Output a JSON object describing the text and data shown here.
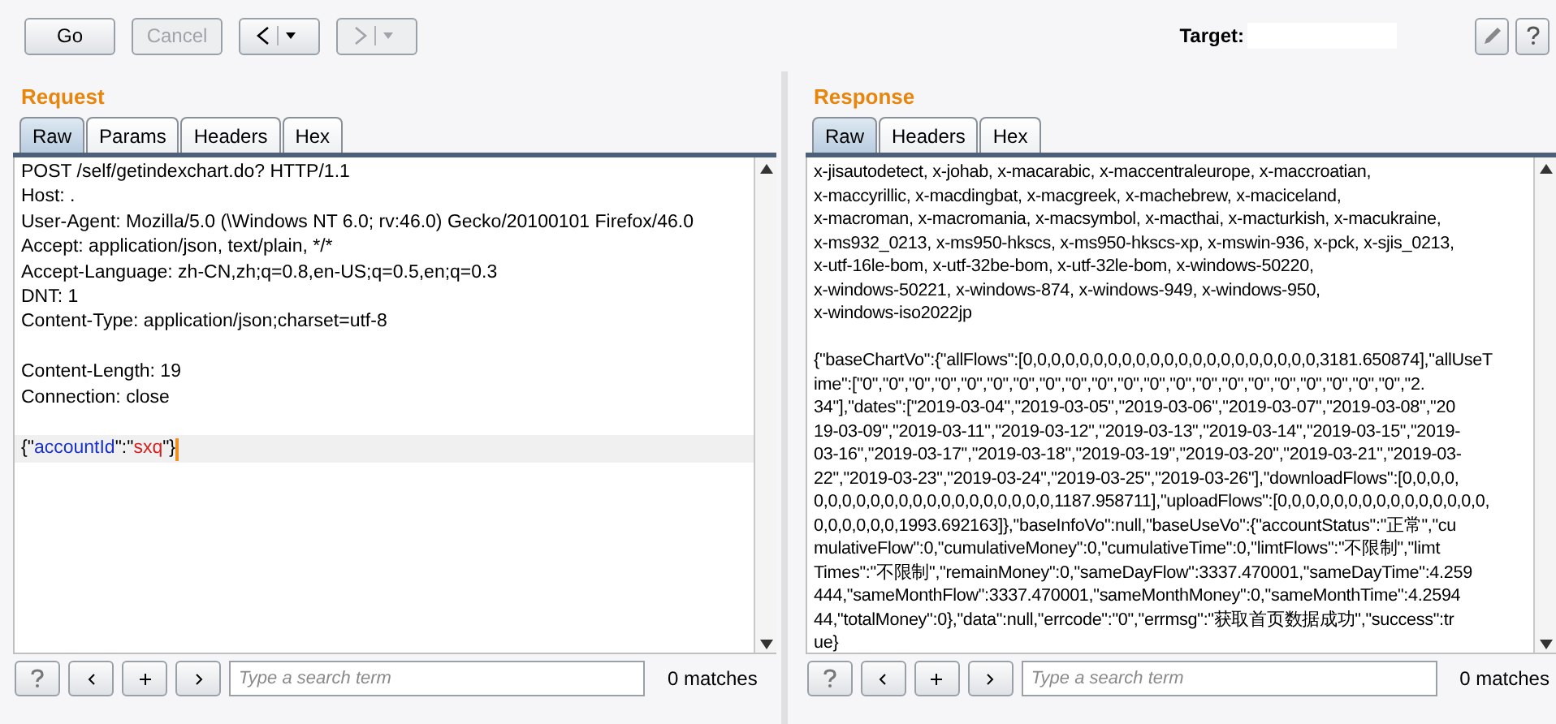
{
  "toolbar": {
    "buttons": [
      {
        "kind": "text",
        "label": "Go",
        "disabled": false
      },
      {
        "kind": "text",
        "label": "Cancel",
        "disabled": true
      },
      {
        "kind": "back",
        "disabled": false
      },
      {
        "kind": "forward",
        "disabled": true
      }
    ],
    "target_label": "Target:"
  },
  "request": {
    "title": "Request",
    "tabs": [
      {
        "label": "Raw",
        "selected": true
      },
      {
        "label": "Params",
        "selected": false
      },
      {
        "label": "Headers",
        "selected": false
      },
      {
        "label": "Hex",
        "selected": false
      }
    ],
    "blocks": [
      [
        "POST /self/getindexchart.do? HTTP/1.1",
        "Host: .",
        "User-Agent: Mozilla/5.0 (\\Windows NT 6.0; rv:46.0) Gecko/20100101 Firefox/46.0",
        "Accept: application/json, text/plain, */*",
        "Accept-Language: zh-CN,zh;q=0.8,en-US;q=0.5,en;q=0.3",
        "DNT: 1",
        "Content-Type: application/json;charset=utf-8"
      ],
      [
        "Content-Length: 19",
        "Connection: close"
      ]
    ],
    "body": [
      {
        "kind": "punct",
        "text": "{\""
      },
      {
        "kind": "key",
        "text": "accountId"
      },
      {
        "kind": "punct",
        "text": "\":\""
      },
      {
        "kind": "value",
        "text": "sxq"
      },
      {
        "kind": "punct",
        "text": "\"}"
      }
    ],
    "search": {
      "placeholder": "Type a search term",
      "matches": "0 matches"
    }
  },
  "response": {
    "title": "Response",
    "tabs": [
      {
        "label": "Raw",
        "selected": true
      },
      {
        "label": "Headers",
        "selected": false
      },
      {
        "label": "Hex",
        "selected": false
      }
    ],
    "blocks": [
      [
        "x-jisautodetect, x-johab, x-macarabic, x-maccentraleurope, x-maccroatian,",
        "x-maccyrillic, x-macdingbat, x-macgreek, x-machebrew, x-maciceland,",
        "x-macroman, x-macromania, x-macsymbol, x-macthai, x-macturkish, x-macukraine,",
        "x-ms932_0213, x-ms950-hkscs, x-ms950-hkscs-xp, x-mswin-936, x-pck, x-sjis_0213,",
        "x-utf-16le-bom, x-utf-32be-bom, x-utf-32le-bom, x-windows-50220,",
        "x-windows-50221, x-windows-874, x-windows-949, x-windows-950,",
        "x-windows-iso2022jp"
      ],
      [
        "{\"baseChartVo\":{\"allFlows\":[0,0,0,0,0,0,0,0,0,0,0,0,0,0,0,0,0,0,0,0,0,3181.650874],\"allUseT",
        "ime\":[\"0\",\"0\",\"0\",\"0\",\"0\",\"0\",\"0\",\"0\",\"0\",\"0\",\"0\",\"0\",\"0\",\"0\",\"0\",\"0\",\"0\",\"0\",\"0\",\"0\",\"0\",\"2.",
        "34\"],\"dates\":[\"2019-03-04\",\"2019-03-05\",\"2019-03-06\",\"2019-03-07\",\"2019-03-08\",\"20",
        "19-03-09\",\"2019-03-11\",\"2019-03-12\",\"2019-03-13\",\"2019-03-14\",\"2019-03-15\",\"2019-",
        "03-16\",\"2019-03-17\",\"2019-03-18\",\"2019-03-19\",\"2019-03-20\",\"2019-03-21\",\"2019-03-",
        "22\",\"2019-03-23\",\"2019-03-24\",\"2019-03-25\",\"2019-03-26\"],\"downloadFlows\":[0,0,0,0,",
        "0,0,0,0,0,0,0,0,0,0,0,0,0,0,0,0,0,1187.958711],\"uploadFlows\":[0,0,0,0,0,0,0,0,0,0,0,0,0,0,0,",
        "0,0,0,0,0,0,1993.692163]},\"baseInfoVo\":null,\"baseUseVo\":{\"accountStatus\":\"正常\",\"cu",
        "mulativeFlow\":0,\"cumulativeMoney\":0,\"cumulativeTime\":0,\"limtFlows\":\"不限制\",\"limt",
        "Times\":\"不限制\",\"remainMoney\":0,\"sameDayFlow\":3337.470001,\"sameDayTime\":4.259",
        "444,\"sameMonthFlow\":3337.470001,\"sameMonthMoney\":0,\"sameMonthTime\":4.2594",
        "44,\"totalMoney\":0},\"data\":null,\"errcode\":\"0\",\"errmsg\":\"获取首页数据成功\",\"success\":tr",
        "ue}"
      ]
    ],
    "search": {
      "placeholder": "Type a search term",
      "matches": "0 matches"
    }
  }
}
